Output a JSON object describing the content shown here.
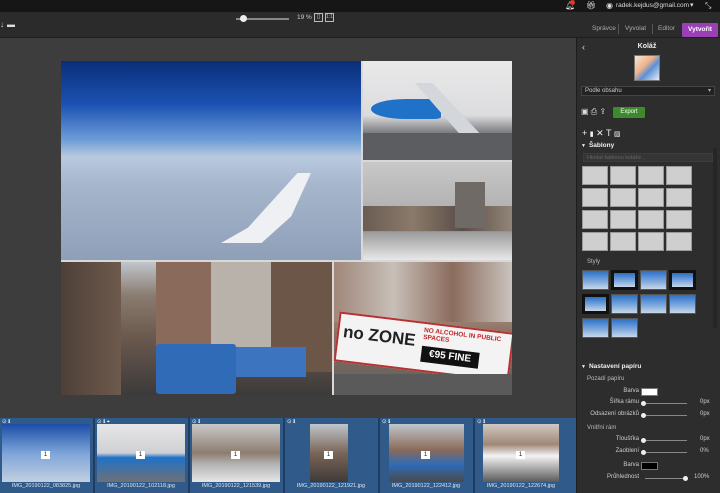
{
  "topbar": {
    "email": "radek.kejdus@gmail.com",
    "bell_icon": "bell-icon",
    "gift_icon": "gift-icon",
    "user_icon": "user-icon"
  },
  "toolbar": {
    "zoom_percent": "19 %",
    "zoom_btn_fit": "[]",
    "zoom_btn_full": "1:1",
    "tabs": [
      "Správce",
      "Vyvolat",
      "Editor",
      "Vytvořit"
    ],
    "active_tab": "Vytvořit",
    "accent": "#9b3fb5"
  },
  "collage": {
    "banner_zone": "no ZONE",
    "banner_alcohol": "NO ALCOHOL IN PUBLIC SPACES",
    "banner_fine": "€95 FINE"
  },
  "filmstrip": {
    "items": [
      {
        "name": "IMG_20190122_083825.jpg",
        "count": "1"
      },
      {
        "name": "IMG_20190122_102118.jpg",
        "count": "1"
      },
      {
        "name": "IMG_20190122_121539.jpg",
        "count": "1"
      },
      {
        "name": "IMG_20190122_121921.jpg",
        "count": "1"
      },
      {
        "name": "IMG_20190122_122412.jpg",
        "count": "1"
      },
      {
        "name": "IMG_20190122_122674.jpg",
        "count": "1"
      }
    ]
  },
  "panel": {
    "title": "Koláž",
    "layout_select": "Podle obsahu",
    "export_label": "Export",
    "templates_header": "Šablony",
    "templates_search_placeholder": "Hledat šablonu koláže...",
    "styles_label": "Styly",
    "paper_header": "Nastavení papíru",
    "paper_bg_label": "Pozadí papíru",
    "color_label": "Barva",
    "frame_width_label": "Šířka rámu",
    "photo_gap_label": "Odsazení obrázků",
    "frame_width_value": "0px",
    "photo_gap_value": "0px",
    "inner_frame_label": "Vnitřní rám",
    "thickness_label": "Tloušťka",
    "thickness_value": "0px",
    "rounding_label": "Zaoblení",
    "rounding_value": "0%",
    "inner_color_label": "Barva",
    "transparency_label": "Průhlednost",
    "transparency_value": "100%",
    "paper_color": "#ffffff",
    "inner_color": "#000000"
  }
}
